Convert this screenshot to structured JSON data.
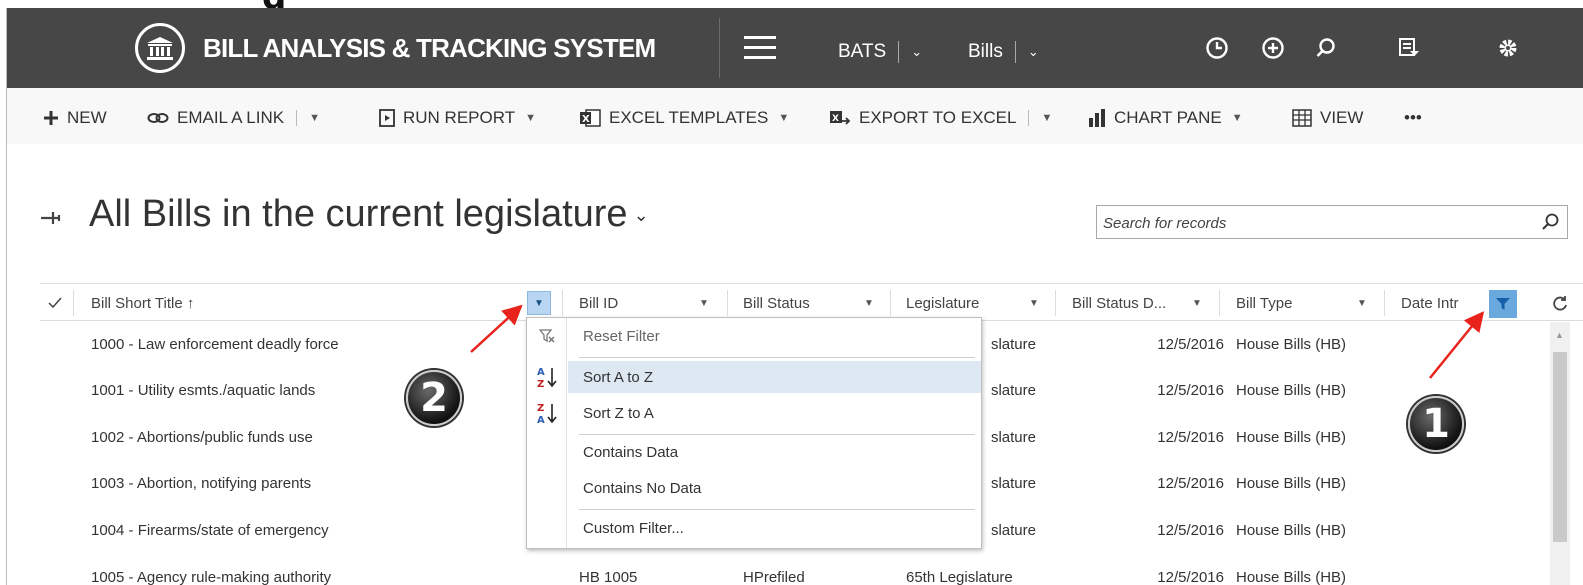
{
  "app": {
    "title": "BILL ANALYSIS & TRACKING SYSTEM",
    "nav": [
      {
        "label": "BATS"
      },
      {
        "label": "Bills"
      }
    ]
  },
  "commands": {
    "new": "NEW",
    "email_link": "EMAIL A LINK",
    "run_report": "RUN REPORT",
    "excel_templates": "EXCEL TEMPLATES",
    "export_excel": "EXPORT TO EXCEL",
    "chart_pane": "CHART PANE",
    "view": "VIEW",
    "more": "•••"
  },
  "view": {
    "title": "All Bills in the current legislature",
    "search_placeholder": "Search for records"
  },
  "grid": {
    "columns": [
      {
        "label": "Bill Short Title ↑"
      },
      {
        "label": "Bill ID"
      },
      {
        "label": "Bill Status"
      },
      {
        "label": "Legislature"
      },
      {
        "label": "Bill Status D..."
      },
      {
        "label": "Bill Type"
      },
      {
        "label": "Date Intr"
      }
    ],
    "rows": [
      {
        "title": "1000 - Law enforcement deadly force",
        "bill_id": "",
        "status": "",
        "legislature": "slature",
        "date": "12/5/2016",
        "type": "House Bills (HB)"
      },
      {
        "title": "1001 - Utility esmts./aquatic lands",
        "bill_id": "",
        "status": "",
        "legislature": "slature",
        "date": "12/5/2016",
        "type": "House Bills (HB)"
      },
      {
        "title": "1002 - Abortions/public funds use",
        "bill_id": "",
        "status": "",
        "legislature": "slature",
        "date": "12/5/2016",
        "type": "House Bills (HB)"
      },
      {
        "title": "1003 - Abortion, notifying parents",
        "bill_id": "",
        "status": "",
        "legislature": "slature",
        "date": "12/5/2016",
        "type": "House Bills (HB)"
      },
      {
        "title": "1004 - Firearms/state of emergency",
        "bill_id": "",
        "status": "",
        "legislature": "slature",
        "date": "12/5/2016",
        "type": "House Bills (HB)"
      },
      {
        "title": "1005 - Agency rule-making authority",
        "bill_id": "HB 1005",
        "status": "HPrefiled",
        "legislature": "65th Legislature",
        "date": "12/5/2016",
        "type": "House Bills (HB)"
      }
    ]
  },
  "menu": {
    "reset_filter": "Reset Filter",
    "sort_az": "Sort A to Z",
    "sort_za": "Sort Z to A",
    "contains_data": "Contains Data",
    "contains_no_data": "Contains No Data",
    "custom_filter": "Custom Filter..."
  },
  "annotations": {
    "badge1": "1",
    "badge2": "2",
    "arrow_color": "#e8231b"
  },
  "colors": {
    "navbar": "#474747",
    "filter_active": "#6aa9de",
    "menu_hover": "#dde8f3"
  }
}
